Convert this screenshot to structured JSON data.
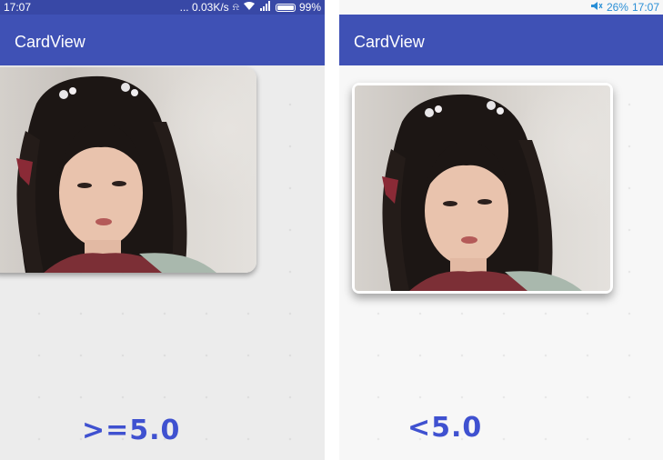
{
  "left_phone": {
    "status": {
      "time": "17:07",
      "net": "... 0.03K/s",
      "battery": "99%"
    },
    "app_title": "CardView",
    "caption": ">=5.0"
  },
  "right_phone": {
    "status": {
      "volume": "26%",
      "time": "17:07"
    },
    "app_title": "CardView",
    "caption": "<5.0"
  },
  "colors": {
    "primary": "#3f51b5",
    "statusbar": "#3848a6",
    "caption": "#3f51d0",
    "status_icon_right": "#2a8fd6"
  },
  "icons": [
    "alarm-icon",
    "wifi-icon",
    "signal-icon",
    "battery-icon",
    "speaker-muted-icon"
  ]
}
